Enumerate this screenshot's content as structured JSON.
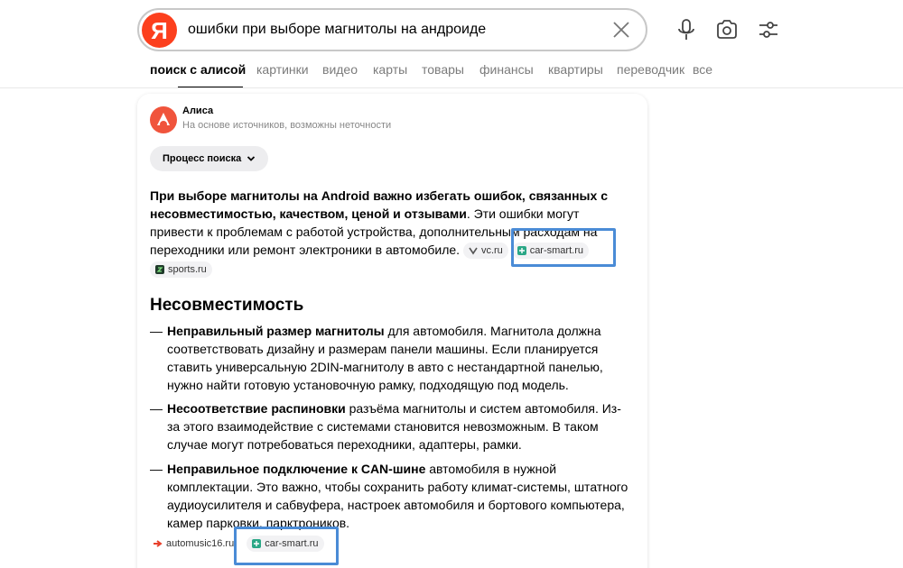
{
  "search": {
    "logo_letter": "Я",
    "query": "ошибки при выборе магнитолы на андроиде"
  },
  "header_icons": [
    "close-icon",
    "microphone-icon",
    "camera-icon",
    "settings-icon"
  ],
  "tabs": [
    {
      "label": "поиск с алисой",
      "active": true
    },
    {
      "label": "картинки"
    },
    {
      "label": "видео"
    },
    {
      "label": "карты"
    },
    {
      "label": "товары"
    },
    {
      "label": "финансы"
    },
    {
      "label": "квартиры"
    },
    {
      "label": "переводчик"
    },
    {
      "label": "все"
    }
  ],
  "alice": {
    "name": "Алиса",
    "subtitle": "На основе источников, возможны неточности",
    "process_button": "Процесс поиска"
  },
  "summary": {
    "bold": "При выборе магнитолы на Android важно избегать ошибок, связанных с несовместимостью, качеством, ценой и отзывами",
    "text": ". Эти ошибки могут привести к проблемам с работой устройства, дополнительным расходам на переходники или ремонт электроники в автомобиле.",
    "sources": [
      "vc.ru",
      "car-smart.ru",
      "sports.ru"
    ]
  },
  "section": {
    "title": "Несовместимость",
    "dash": "—",
    "items": [
      {
        "bold": "Неправильный размер магнитолы",
        "text": " для автомобиля. Магнитола должна соответствовать дизайну и размерам панели машины. Если планируется ставить универсальную 2DIN-магнитолу в авто с нестандартной панелью, нужно найти готовую установочную рамку, подходящую под модель."
      },
      {
        "bold": "Несоответствие распиновки",
        "text": " разъёма магнитолы и систем автомобиля. Из-за этого взаимодействие с системами становится невозможным. В таком случае могут потребоваться переходники, адаптеры, рамки."
      },
      {
        "bold": "Неправильное подключение к CAN-шине",
        "text": " автомобиля в нужной комплектации. Это важно, чтобы сохранить работу климат-системы, штатного аудиоусилителя и сабвуфера, настроек автомобиля и бортового компьютера, камер парковки, парктроников."
      }
    ],
    "sources": [
      "automusic16.ru",
      "car-smart.ru"
    ]
  },
  "colors": {
    "brand": "#fc3f1d",
    "highlight": "#4a8bd6",
    "chip_bg": "#f2f2f4"
  }
}
